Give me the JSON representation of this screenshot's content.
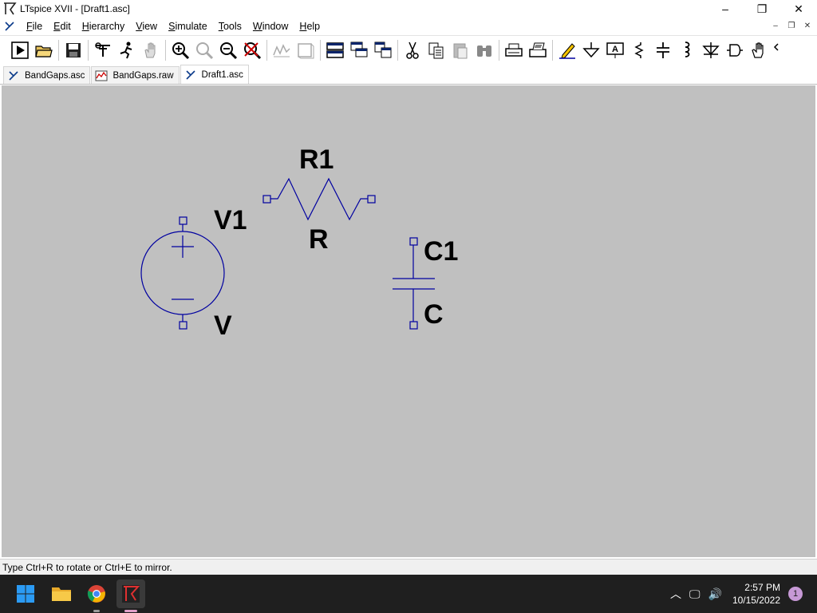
{
  "window": {
    "title": "LTspice XVII - [Draft1.asc]",
    "minimize": "–",
    "maximize": "❐",
    "close": "✕"
  },
  "menu": {
    "items": [
      "File",
      "Edit",
      "Hierarchy",
      "View",
      "Simulate",
      "Tools",
      "Window",
      "Help"
    ],
    "mdi_minimize": "–",
    "mdi_restore": "❐",
    "mdi_close": "✕"
  },
  "toolbar": {
    "icons": [
      "run-icon",
      "open-icon",
      "save-icon",
      "control-panel-icon",
      "halt-icon",
      "pan-icon",
      "zoom-in-icon",
      "zoom-full-icon",
      "zoom-out-icon",
      "zoom-cancel-icon",
      "autorange-icon",
      "waveform-icon",
      "tile-horizontal-icon",
      "cascade-icon",
      "tile-vertical-icon",
      "cut-icon",
      "copy-icon",
      "paste-icon",
      "find-icon",
      "print-setup-icon",
      "print-icon",
      "draw-wire-icon",
      "ground-icon",
      "label-net-icon",
      "resistor-icon",
      "capacitor-icon",
      "inductor-icon",
      "diode-icon",
      "component-icon",
      "move-icon"
    ]
  },
  "tabs": [
    {
      "label": "BandGaps.asc",
      "icon": "schematic-icon",
      "active": false
    },
    {
      "label": "BandGaps.raw",
      "icon": "waveform-icon",
      "active": false
    },
    {
      "label": "Draft1.asc",
      "icon": "schematic-icon",
      "active": true
    }
  ],
  "schematic": {
    "wire_color": "#0000a0",
    "components": [
      {
        "ref": "R1",
        "value": "R",
        "type": "resistor"
      },
      {
        "ref": "V1",
        "value": "V",
        "type": "voltage-source"
      },
      {
        "ref": "C1",
        "value": "C",
        "type": "capacitor"
      }
    ]
  },
  "status": {
    "text": "Type Ctrl+R to rotate or Ctrl+E to mirror."
  },
  "taskbar": {
    "apps": [
      "windows-start-icon",
      "file-explorer-icon",
      "chrome-icon",
      "ltspice-icon"
    ],
    "time": "2:57 PM",
    "date": "10/15/2022",
    "notification_count": "1"
  }
}
